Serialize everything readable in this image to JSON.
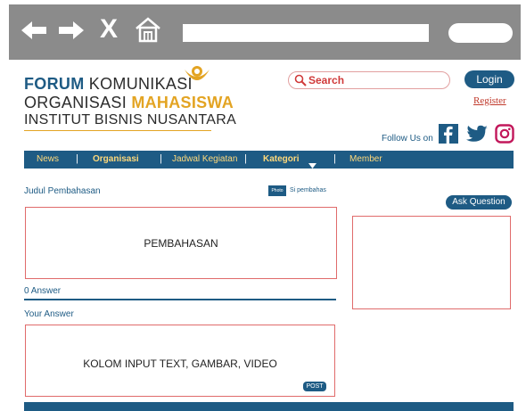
{
  "browser": {
    "back_icon": "arrow-left-icon",
    "forward_icon": "arrow-right-icon",
    "close_label": "X",
    "home_icon": "home-icon"
  },
  "header": {
    "logo_line1_a": "FORUM",
    "logo_line1_b": " KOMUNIKASI",
    "logo_line2_a": "ORGANISASI ",
    "logo_line2_b": "MAHASISWA",
    "logo_line3": "INSTITUT BISNIS NUSANTARA",
    "search_placeholder": "Search",
    "login_label": "Login",
    "register_label": "Register",
    "follow_label": "Follow Us on"
  },
  "nav": {
    "items": [
      "News",
      "Organisasi",
      "Jadwal Kegiatan",
      "Kategori",
      "Member"
    ]
  },
  "content": {
    "topic_title": "Judul Pembahasan",
    "photo_badge": "Photo",
    "author_label": "Si pembahas",
    "ask_label": "Ask Question",
    "discussion_placeholder": "PEMBAHASAN",
    "answer_count": "0 Answer",
    "your_answer_label": "Your Answer",
    "input_placeholder": "KOLOM INPUT TEXT, GAMBAR, VIDEO",
    "post_label": "POST"
  },
  "colors": {
    "primary": "#1e5b84",
    "accent_gold": "#e3a423",
    "accent_red": "#e06b6b",
    "chrome_gray": "#8b8b8b"
  }
}
